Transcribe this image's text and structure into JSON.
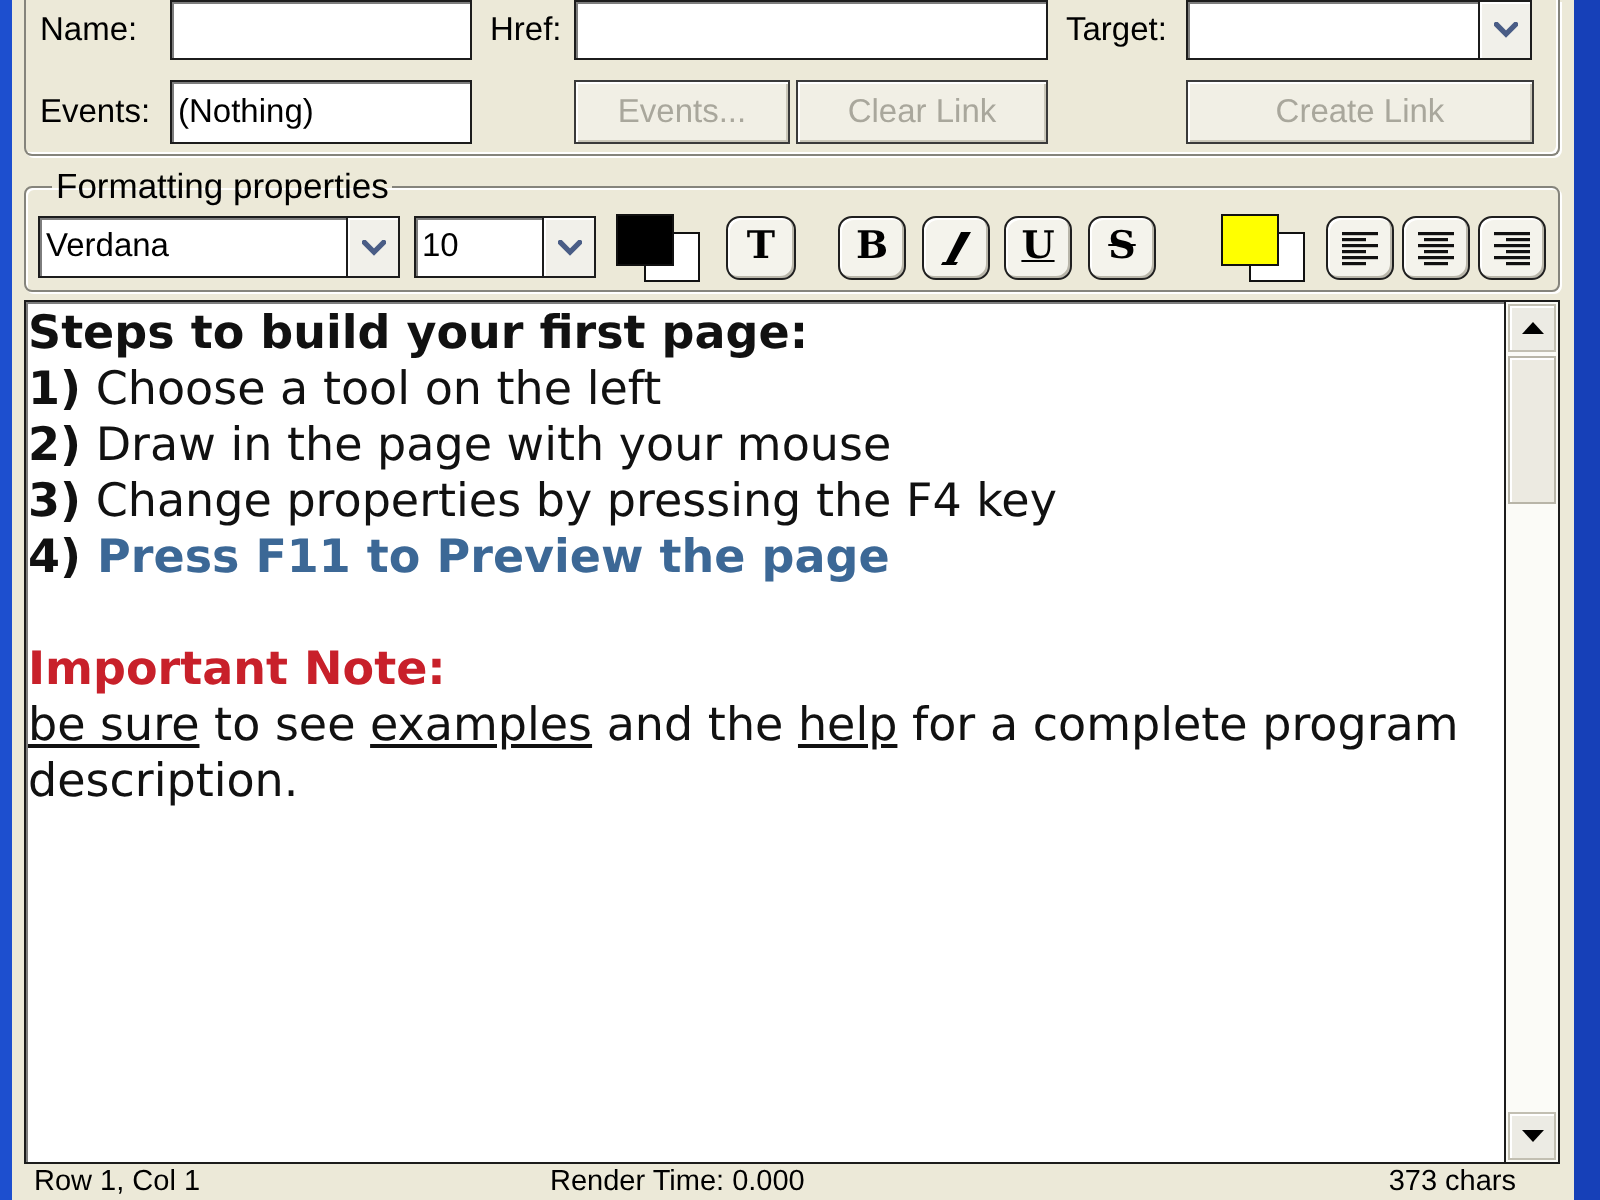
{
  "link_properties": {
    "name": {
      "label": "Name:"
    },
    "href": {
      "label": "Href:"
    },
    "target": {
      "label": "Target:"
    },
    "events": {
      "label": "Events:",
      "value": "(Nothing)"
    },
    "buttons": [
      {
        "label": "Events...",
        "disabled": true
      },
      {
        "label": "Clear Link",
        "disabled": true
      },
      {
        "label": "Create Link",
        "disabled": true
      }
    ]
  },
  "formatting": {
    "title": "Formatting properties",
    "font": "Verdana",
    "size": "10",
    "text_color": {
      "color": "#000000"
    },
    "style_buttons": [
      {
        "kind": "font",
        "label": "T"
      },
      {
        "kind": "bold",
        "label": "B"
      },
      {
        "kind": "italic"
      },
      {
        "kind": "underline",
        "label": "U"
      },
      {
        "kind": "strikethrough",
        "label": "S"
      }
    ],
    "highlight_color": {
      "color": "#ffff00"
    },
    "align_buttons": [
      {
        "kind": "left"
      },
      {
        "kind": "center"
      },
      {
        "kind": "right"
      }
    ]
  },
  "editor": {
    "paragraphs": [
      {
        "space_before": false,
        "runs": [
          {
            "text": "Steps to build your first page:",
            "bold": true,
            "underline": false
          }
        ]
      },
      {
        "space_before": false,
        "runs": [
          {
            "text": "1)",
            "bold": true,
            "underline": false
          },
          {
            "text": " Choose a tool on the left",
            "bold": false,
            "underline": false
          }
        ]
      },
      {
        "space_before": false,
        "runs": [
          {
            "text": "2)",
            "bold": true,
            "underline": false
          },
          {
            "text": " Draw in the page with your mouse",
            "bold": false,
            "underline": false
          }
        ]
      },
      {
        "space_before": false,
        "runs": [
          {
            "text": "3)",
            "bold": true,
            "underline": false
          },
          {
            "text": " Change properties by pressing the F4 key",
            "bold": false,
            "underline": false
          }
        ]
      },
      {
        "space_before": false,
        "runs": [
          {
            "text": "4)",
            "bold": true,
            "underline": false
          },
          {
            "text": " Press F11 to Preview the page",
            "bold": true,
            "underline": false,
            "color": "#3c6896"
          }
        ]
      },
      {
        "space_before": true,
        "runs": [
          {
            "text": "Important Note:",
            "bold": true,
            "underline": false,
            "color": "#c8202a"
          }
        ]
      },
      {
        "space_before": false,
        "runs": [
          {
            "text": "be sure",
            "bold": false,
            "underline": true
          },
          {
            "text": " to see ",
            "bold": false,
            "underline": false
          },
          {
            "text": "examples",
            "bold": false,
            "underline": true
          },
          {
            "text": " and the ",
            "bold": false,
            "underline": false
          },
          {
            "text": "help",
            "bold": false,
            "underline": true
          },
          {
            "text": " for a complete program description.",
            "bold": false,
            "underline": false
          }
        ]
      }
    ]
  },
  "status_bar": {
    "position": "Row 1, Col 1",
    "render_time": "Render Time: 0.000",
    "char_count": "373 chars"
  }
}
